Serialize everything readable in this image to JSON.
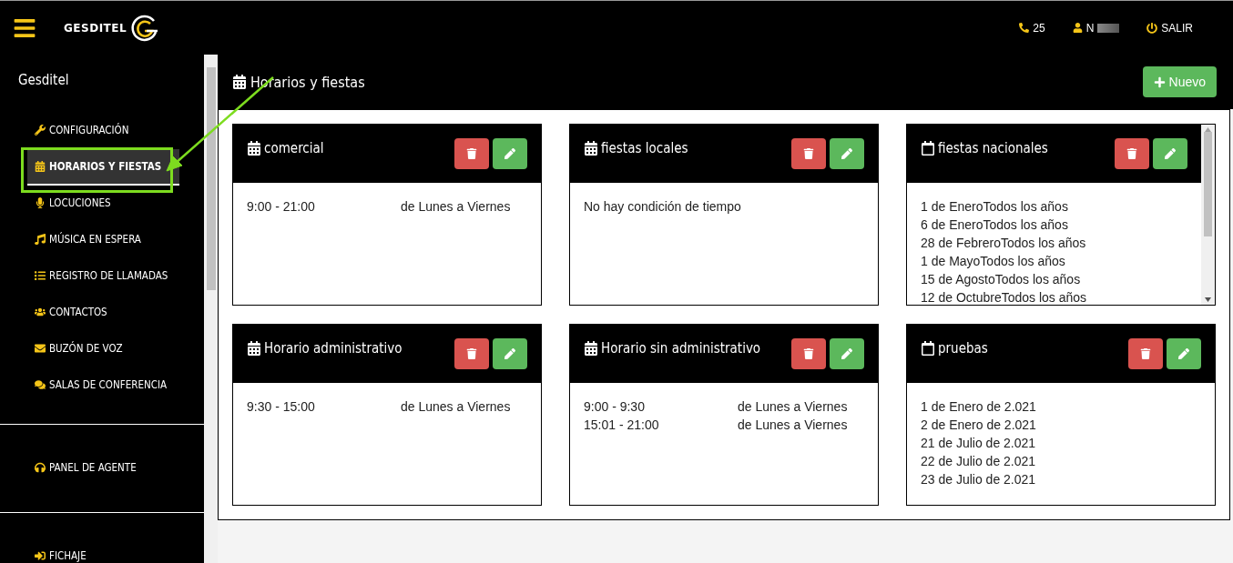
{
  "header": {
    "brand": "GESDITEL",
    "phone_count": "25",
    "user": "N",
    "logout": "SALIR"
  },
  "sidebar": {
    "title": "Gesditel",
    "sections": [
      {
        "items": [
          {
            "label": "CONFIGURACIÓN",
            "selected": false
          },
          {
            "label": "HORARIOS Y FIESTAS",
            "selected": true
          },
          {
            "label": "LOCUCIONES",
            "selected": false
          },
          {
            "label": "MÚSICA EN ESPERA",
            "selected": false
          },
          {
            "label": "REGISTRO DE LLAMADAS",
            "selected": false
          },
          {
            "label": "CONTACTOS",
            "selected": false
          },
          {
            "label": "BUZÓN DE VOZ",
            "selected": false
          },
          {
            "label": "SALAS DE CONFERENCIA",
            "selected": false
          }
        ]
      },
      {
        "items": [
          {
            "label": "PANEL DE AGENTE",
            "selected": false
          }
        ]
      },
      {
        "items": [
          {
            "label": "FICHAJE",
            "selected": false
          }
        ]
      }
    ]
  },
  "page": {
    "title": "Horarios y fiestas",
    "new_button": "Nuevo"
  },
  "cards": [
    {
      "kind": "schedule",
      "title": "comercial",
      "rows": [
        {
          "time": "9:00 - 21:00",
          "days": "de Lunes a Viernes"
        }
      ]
    },
    {
      "kind": "message",
      "title": "fiestas locales",
      "text": "No hay condición de tiempo"
    },
    {
      "kind": "dates",
      "title": "fiestas nacionales",
      "scrollable": true,
      "dates": [
        "1 de EneroTodos los años",
        "6 de EneroTodos los años",
        "28 de FebreroTodos los años",
        "1 de MayoTodos los años",
        "15 de AgostoTodos los años",
        "12 de OctubreTodos los años"
      ]
    },
    {
      "kind": "schedule",
      "title": "Horario administrativo",
      "rows": [
        {
          "time": "9:30 - 15:00",
          "days": "de Lunes a Viernes"
        }
      ]
    },
    {
      "kind": "schedule",
      "title": "Horario sin administrativo",
      "rows": [
        {
          "time": "9:00 - 9:30",
          "days": "de Lunes a Viernes"
        },
        {
          "time": "15:01 - 21:00",
          "days": "de Lunes a Viernes"
        }
      ]
    },
    {
      "kind": "dates",
      "title": "pruebas",
      "scrollable": false,
      "dates": [
        "1 de Enero de 2.021",
        "2 de Enero de 2.021",
        "21 de Julio de 2.021",
        "22 de Julio de 2.021",
        "23 de Julio de 2.021"
      ]
    }
  ]
}
